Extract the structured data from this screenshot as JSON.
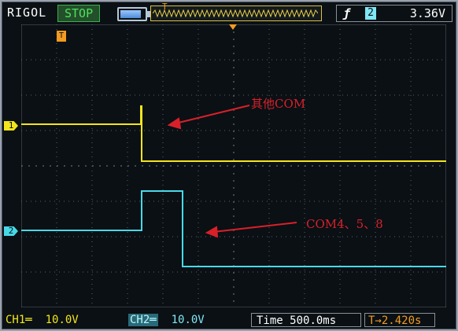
{
  "header": {
    "brand": "RIGOL",
    "run_status": "STOP",
    "trigger_edge_symbol": "ƒ",
    "trigger_source": "2",
    "trigger_level": "3.36V",
    "trigger_marker": "T"
  },
  "channels": {
    "ch1": {
      "marker": "1",
      "label": "CH1",
      "coupling_symbol": "═",
      "scale": "10.0V",
      "color": "#f2e51c"
    },
    "ch2": {
      "marker": "2",
      "label": "CH2",
      "coupling_symbol": "═",
      "scale": "10.0V",
      "color": "#48d9e8"
    }
  },
  "timebase": {
    "label": "Time",
    "value": "500.0ms",
    "trigger_offset": "2.420s",
    "trigger_offset_prefix": "T→"
  },
  "annotations": {
    "top": "其他COM",
    "bottom": "COM4、5、8"
  },
  "colors": {
    "background": "#0a1014",
    "grid": "#5b6168",
    "annotation": "#d9202a",
    "trigger": "#f39a20"
  }
}
